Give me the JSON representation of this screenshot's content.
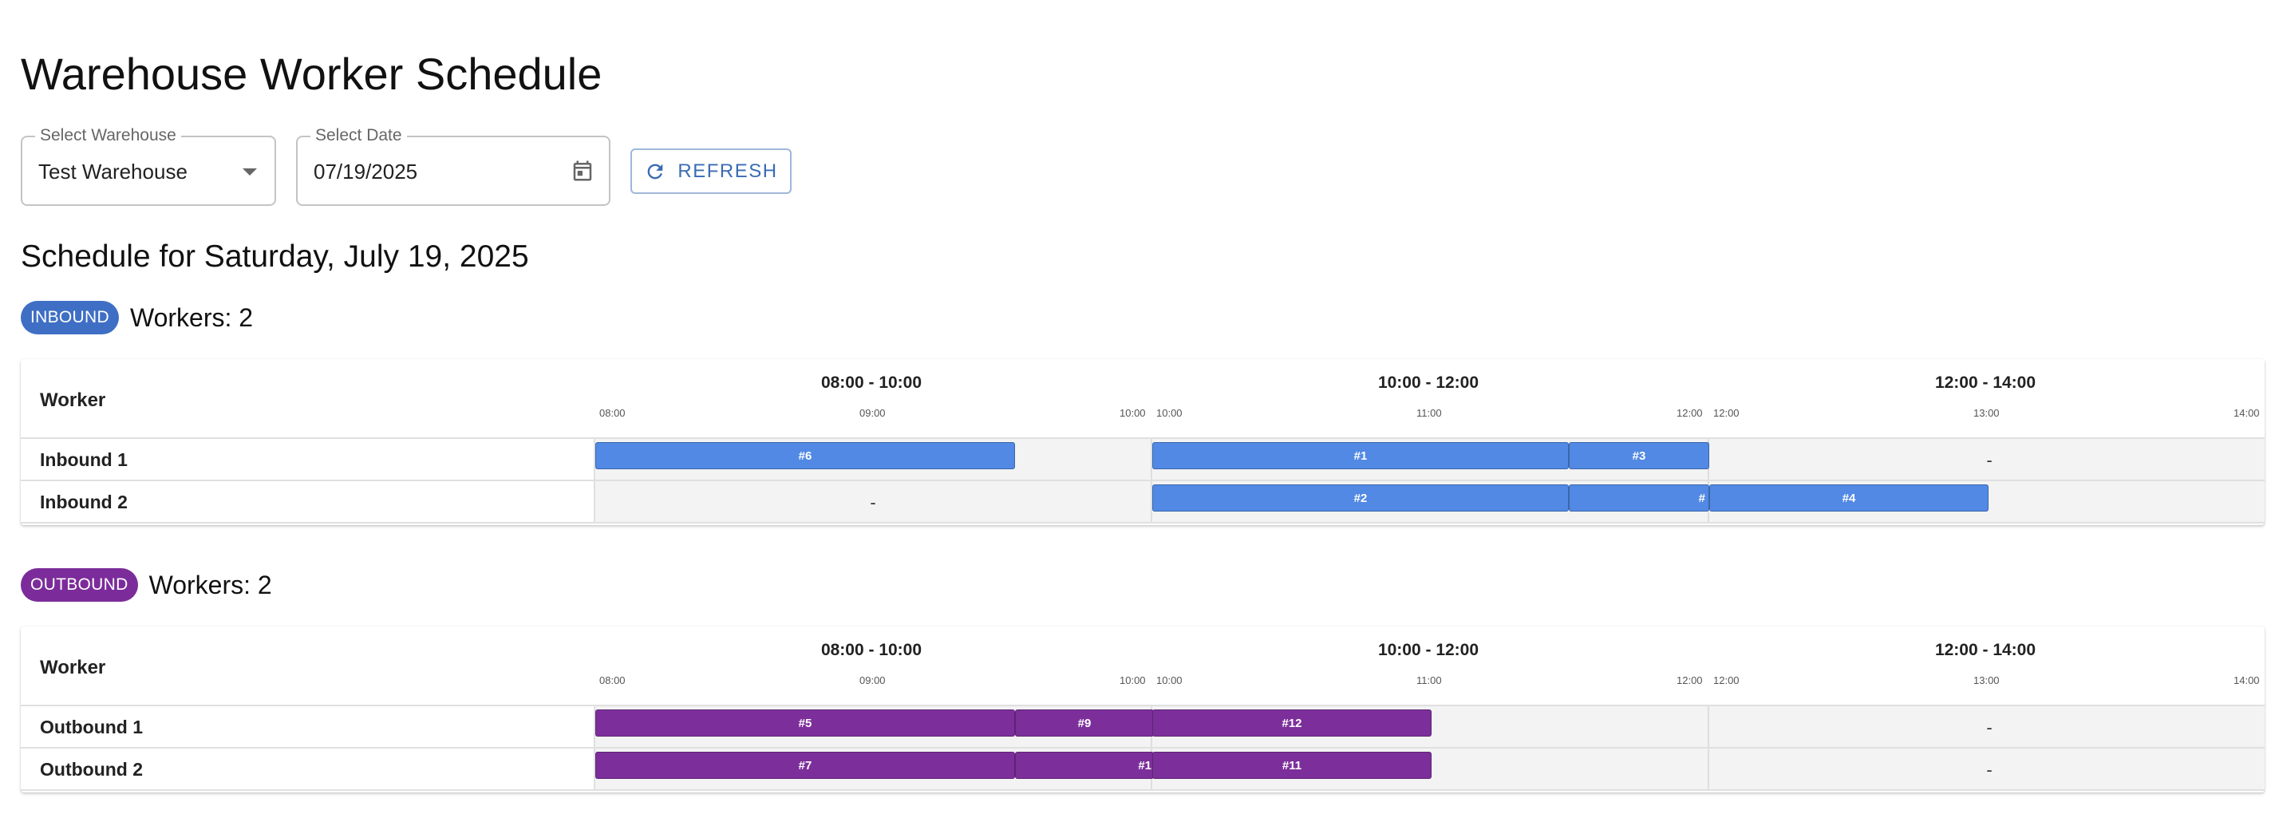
{
  "title": "Warehouse Worker Schedule",
  "controls": {
    "warehouse_label": "Select Warehouse",
    "warehouse_value": "Test Warehouse",
    "date_label": "Select Date",
    "date_value": "07/19/2025",
    "refresh_label": "REFRESH"
  },
  "schedule_heading": "Schedule for Saturday, July 19, 2025",
  "colors": {
    "inbound": "#3f6fc4",
    "outbound": "#7b2c9a",
    "inbound_bar": "#5189e4",
    "outbound_bar": "#7c2f9b"
  },
  "table_header": {
    "worker_label": "Worker",
    "slots": [
      {
        "label": "08:00 - 10:00",
        "start_tick": "08:00",
        "mid_tick": "09:00",
        "end_tick": "10:00"
      },
      {
        "label": "10:00 - 12:00",
        "start_tick": "10:00",
        "mid_tick": "11:00",
        "end_tick": "12:00"
      },
      {
        "label": "12:00 - 14:00",
        "start_tick": "12:00",
        "mid_tick": "13:00",
        "end_tick": "14:00"
      }
    ]
  },
  "sections": [
    {
      "chip": "INBOUND",
      "workers_text": "Workers: 2",
      "rows": [
        {
          "name": "Inbound 1",
          "empty_slots": [
            "-",
            "",
            "-"
          ],
          "tasks": [
            {
              "label": "#6",
              "start": "08:00",
              "end": "09:30"
            },
            {
              "label": "#1",
              "start": "10:00",
              "end": "11:30"
            },
            {
              "label": "#3",
              "start": "11:30",
              "end": "12:00"
            }
          ]
        },
        {
          "name": "Inbound 2",
          "empty_slots": [
            "-",
            "",
            ""
          ],
          "tasks": [
            {
              "label": "#2",
              "start": "10:00",
              "end": "11:30"
            },
            {
              "label": "#",
              "start": "11:30",
              "end": "12:00"
            },
            {
              "label": "#4",
              "start": "12:00",
              "end": "13:00"
            }
          ]
        }
      ]
    },
    {
      "chip": "OUTBOUND",
      "workers_text": "Workers: 2",
      "rows": [
        {
          "name": "Outbound 1",
          "empty_slots": [
            "",
            "",
            "-"
          ],
          "tasks": [
            {
              "label": "#5",
              "start": "08:00",
              "end": "09:30"
            },
            {
              "label": "#9",
              "start": "09:30",
              "end": "10:00"
            },
            {
              "label": "#12",
              "start": "10:00",
              "end": "11:00"
            }
          ]
        },
        {
          "name": "Outbound 2",
          "empty_slots": [
            "",
            "",
            "-"
          ],
          "tasks": [
            {
              "label": "#7",
              "start": "08:00",
              "end": "09:30"
            },
            {
              "label": "#1",
              "start": "09:30",
              "end": "10:00"
            },
            {
              "label": "#11",
              "start": "10:00",
              "end": "11:00"
            }
          ]
        }
      ]
    }
  ]
}
